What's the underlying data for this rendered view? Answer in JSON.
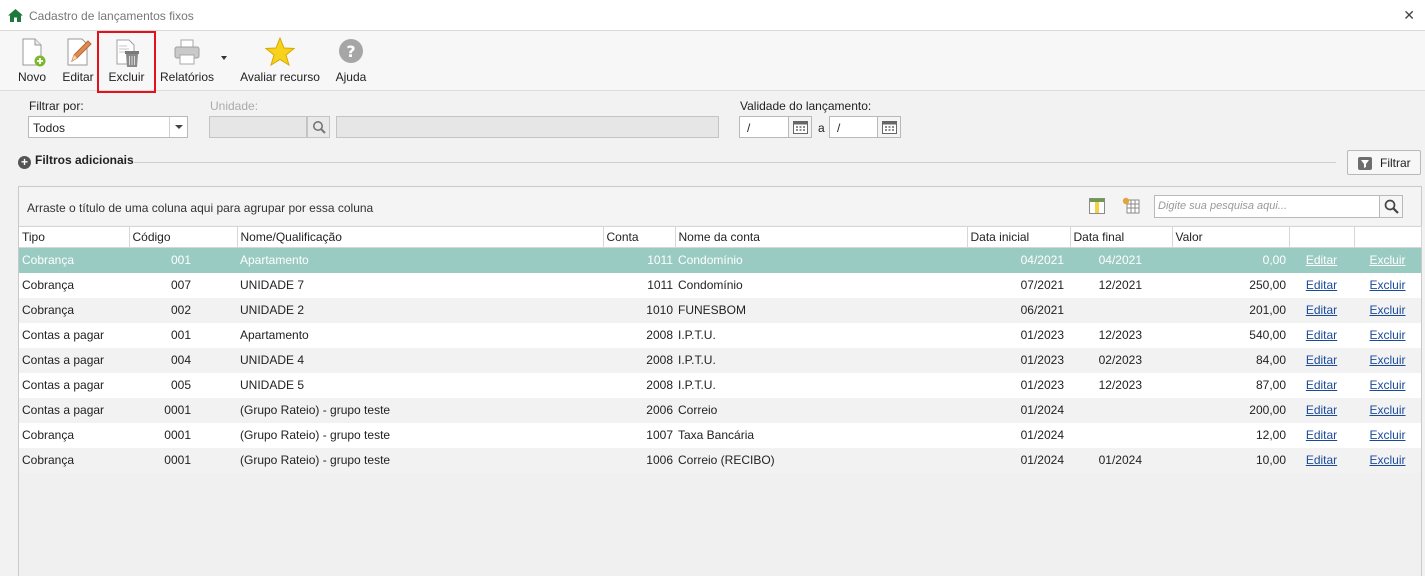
{
  "window": {
    "title": "Cadastro de lançamentos fixos"
  },
  "toolbar": {
    "novo": "Novo",
    "editar": "Editar",
    "excluir": "Excluir",
    "relatorios": "Relatórios",
    "avaliar": "Avaliar recurso",
    "ajuda": "Ajuda"
  },
  "filters": {
    "filtrar_por_label": "Filtrar por:",
    "filtrar_por_value": "Todos",
    "unidade_label": "Unidade:",
    "validade_label": "Validade do lançamento:",
    "date_from": "/",
    "date_sep": "a",
    "date_to": "/",
    "adicionais_label": "Filtros adicionais",
    "filtrar_button": "Filtrar"
  },
  "grid": {
    "group_hint": "Arraste o título de uma coluna aqui para agrupar por essa coluna",
    "search_placeholder": "Digite sua pesquisa aqui...",
    "columns": [
      "Tipo",
      "Código",
      "Nome/Qualificação",
      "Conta",
      "Nome da conta",
      "Data inicial",
      "Data final",
      "Valor",
      "",
      ""
    ],
    "rows": [
      {
        "tipo": "Cobrança",
        "codigo": "001",
        "nome": "Apartamento",
        "conta": "1011",
        "nome_conta": "Condomínio",
        "data_inicial": "04/2021",
        "data_final": "04/2021",
        "valor": "0,00",
        "editar": "Editar",
        "excluir": "Excluir"
      },
      {
        "tipo": "Cobrança",
        "codigo": "007",
        "nome": "UNIDADE 7",
        "conta": "1011",
        "nome_conta": "Condomínio",
        "data_inicial": "07/2021",
        "data_final": "12/2021",
        "valor": "250,00",
        "editar": "Editar",
        "excluir": "Excluir"
      },
      {
        "tipo": "Cobrança",
        "codigo": "002",
        "nome": "UNIDADE 2",
        "conta": "1010",
        "nome_conta": "FUNESBOM",
        "data_inicial": "06/2021",
        "data_final": "",
        "valor": "201,00",
        "editar": "Editar",
        "excluir": "Excluir"
      },
      {
        "tipo": "Contas a pagar",
        "codigo": "001",
        "nome": "Apartamento",
        "conta": "2008",
        "nome_conta": "I.P.T.U.",
        "data_inicial": "01/2023",
        "data_final": "12/2023",
        "valor": "540,00",
        "editar": "Editar",
        "excluir": "Excluir"
      },
      {
        "tipo": "Contas a pagar",
        "codigo": "004",
        "nome": "UNIDADE 4",
        "conta": "2008",
        "nome_conta": "I.P.T.U.",
        "data_inicial": "01/2023",
        "data_final": "02/2023",
        "valor": "84,00",
        "editar": "Editar",
        "excluir": "Excluir"
      },
      {
        "tipo": "Contas a pagar",
        "codigo": "005",
        "nome": "UNIDADE 5",
        "conta": "2008",
        "nome_conta": "I.P.T.U.",
        "data_inicial": "01/2023",
        "data_final": "12/2023",
        "valor": "87,00",
        "editar": "Editar",
        "excluir": "Excluir"
      },
      {
        "tipo": "Contas a pagar",
        "codigo": "0001",
        "nome": "(Grupo Rateio) - grupo teste",
        "conta": "2006",
        "nome_conta": "Correio",
        "data_inicial": "01/2024",
        "data_final": "",
        "valor": "200,00",
        "editar": "Editar",
        "excluir": "Excluir"
      },
      {
        "tipo": "Cobrança",
        "codigo": "0001",
        "nome": "(Grupo Rateio) - grupo teste",
        "conta": "1007",
        "nome_conta": "Taxa Bancária",
        "data_inicial": "01/2024",
        "data_final": "",
        "valor": "12,00",
        "editar": "Editar",
        "excluir": "Excluir"
      },
      {
        "tipo": "Cobrança",
        "codigo": "0001",
        "nome": "(Grupo Rateio) - grupo teste",
        "conta": "1006",
        "nome_conta": "Correio (RECIBO)",
        "data_inicial": "01/2024",
        "data_final": "01/2024",
        "valor": "10,00",
        "editar": "Editar",
        "excluir": "Excluir"
      }
    ]
  },
  "colors": {
    "selected_row": "#99cbc2",
    "link": "#1a4a9a",
    "highlight_border": "#e5101a"
  }
}
